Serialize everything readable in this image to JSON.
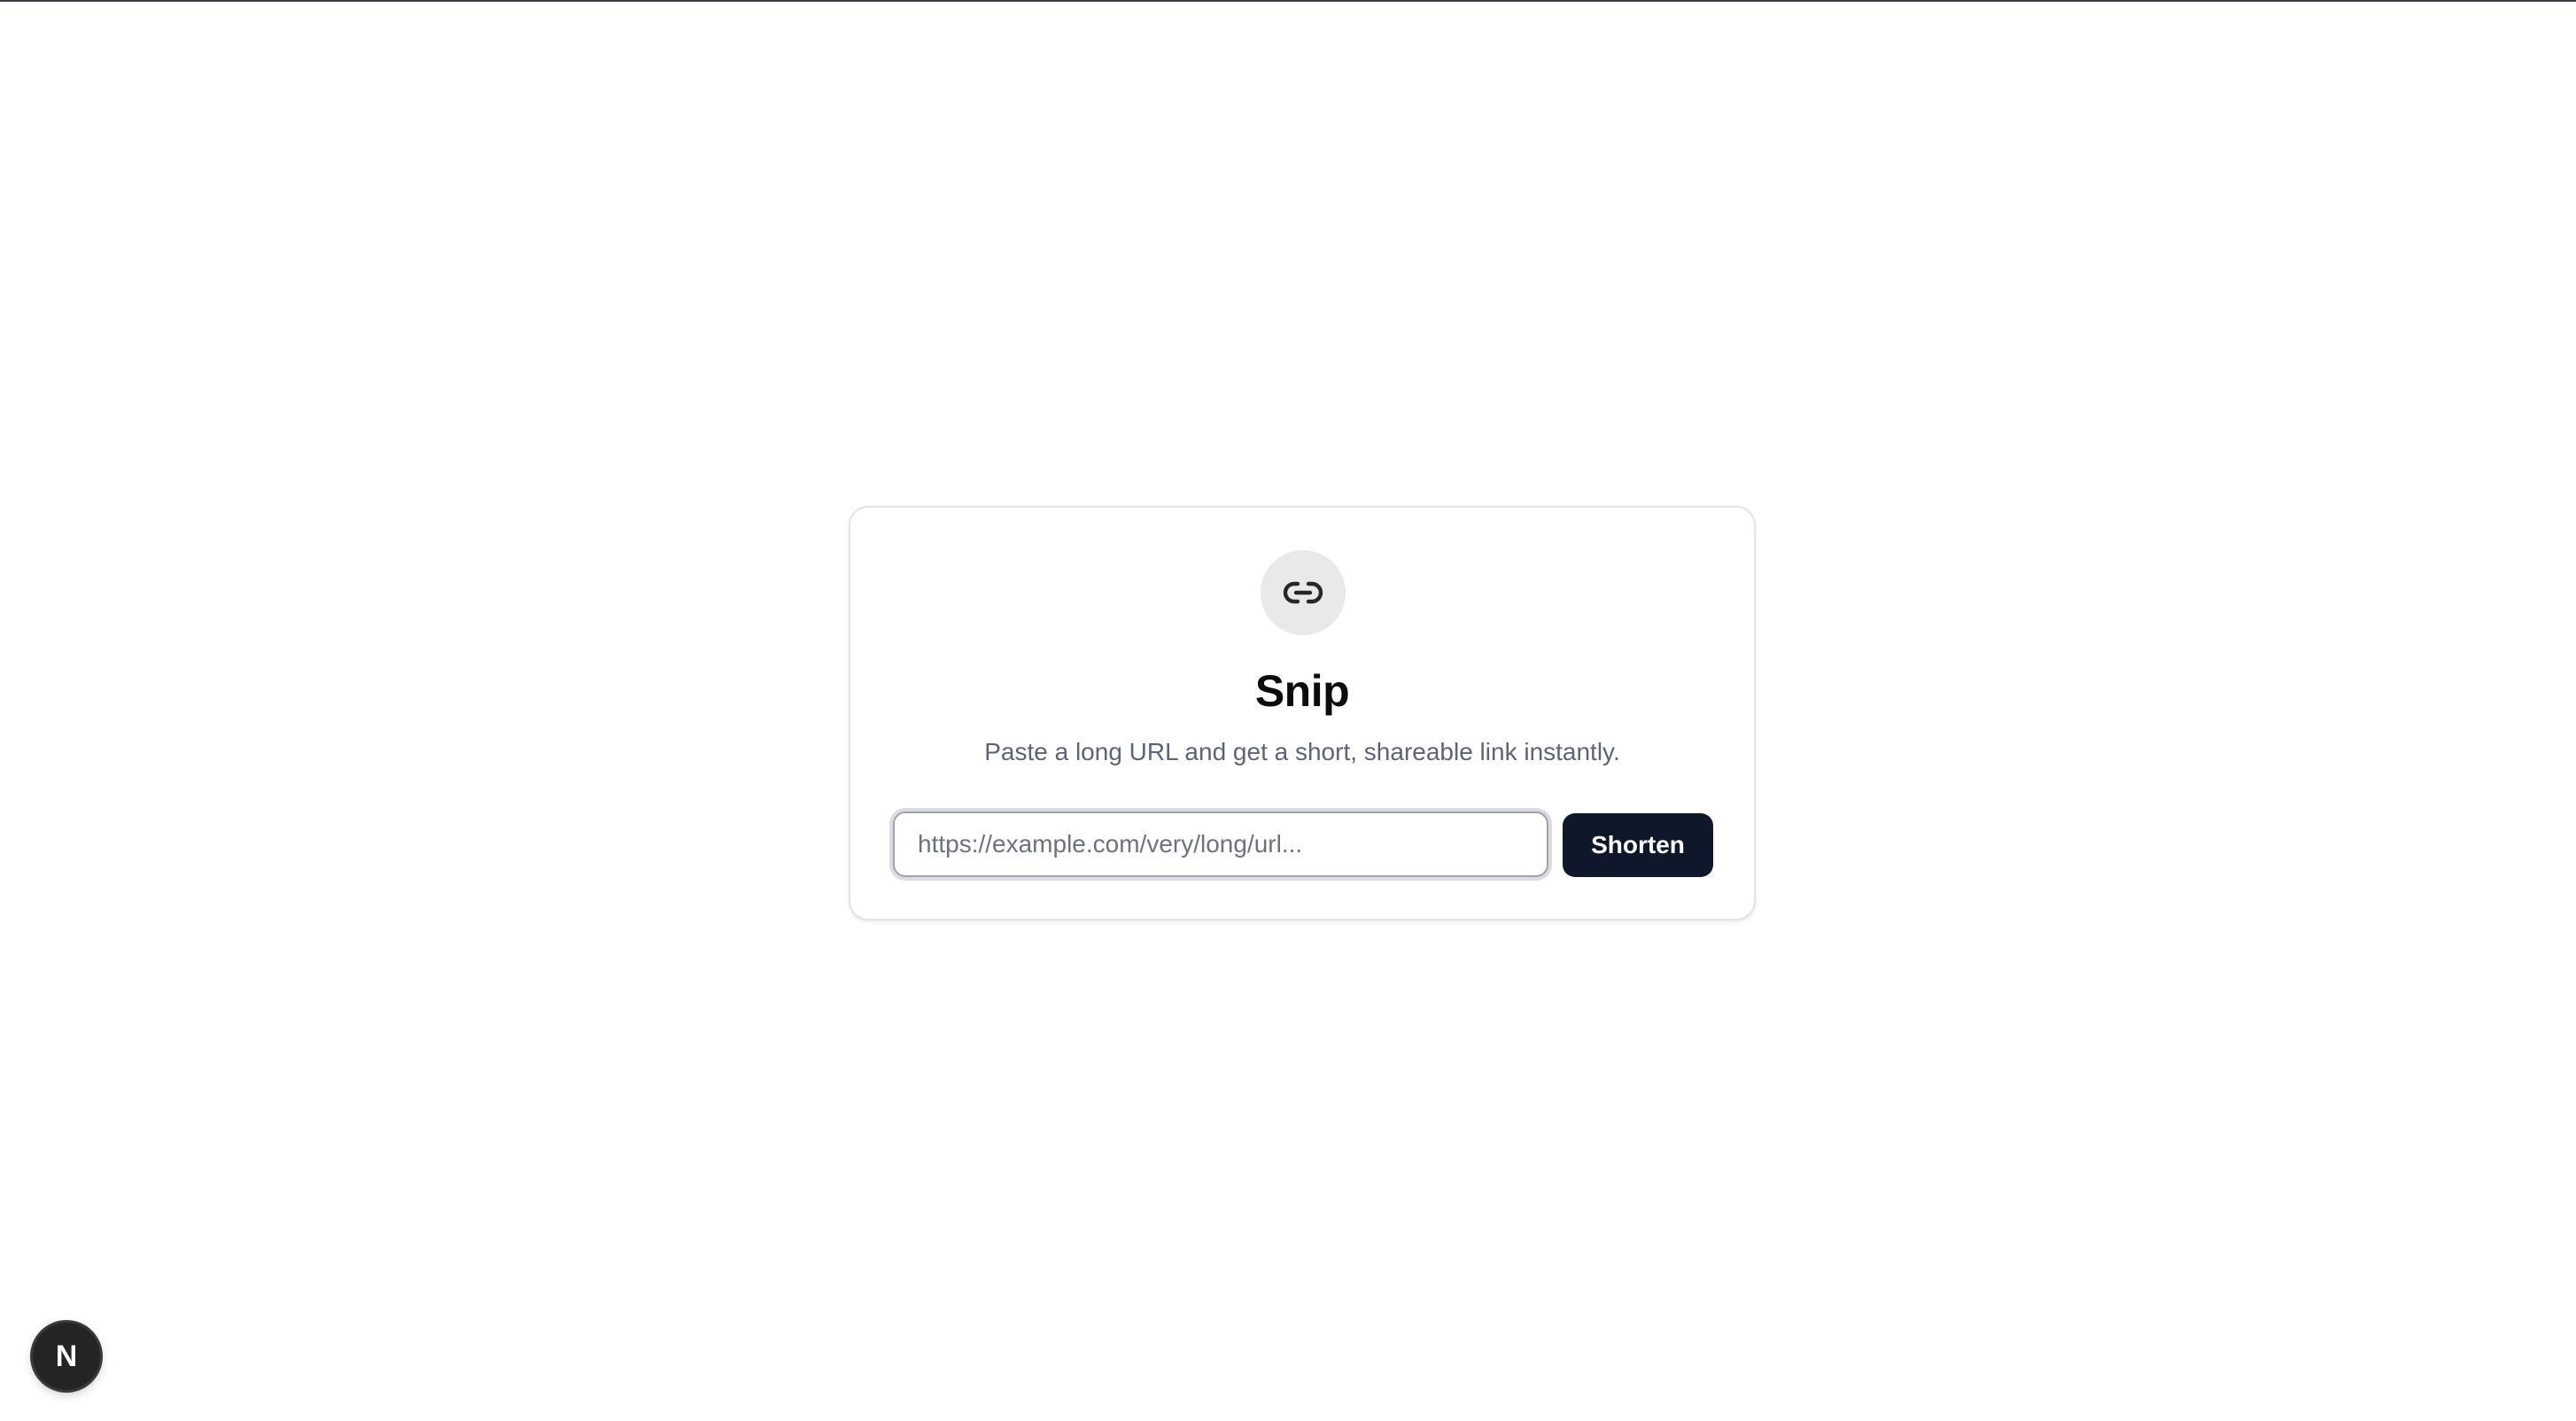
{
  "app": {
    "title": "Snip",
    "subtitle": "Paste a long URL and get a short, shareable link instantly.",
    "logo_icon": "link-icon"
  },
  "form": {
    "url_placeholder": "https://example.com/very/long/url...",
    "url_value": "",
    "submit_label": "Shorten"
  },
  "dev_badge": {
    "label": "N",
    "icon": "nextjs-logo-icon"
  },
  "colors": {
    "button_bg": "#0f172a",
    "title": "#0b0b12",
    "subtitle": "#5b6478",
    "icon_circle": "#e9e9ec"
  }
}
